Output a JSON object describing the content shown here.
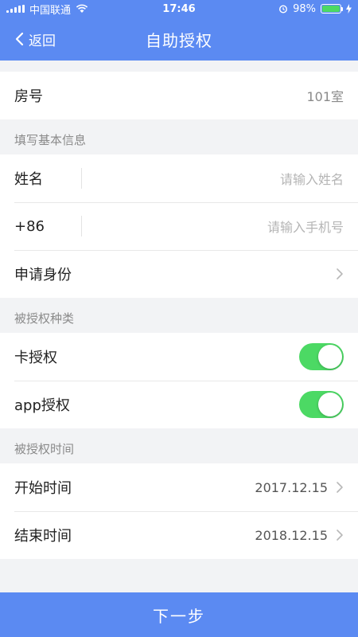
{
  "status_bar": {
    "carrier": "中国联通",
    "time": "17:46",
    "battery": "98%",
    "battery_level": 0.98
  },
  "nav": {
    "back_label": "返回",
    "title": "自助授权"
  },
  "room": {
    "label": "房号",
    "value": "101室"
  },
  "basic_info": {
    "section_title": "填写基本信息",
    "name": {
      "label": "姓名",
      "placeholder": "请输入姓名"
    },
    "phone": {
      "label": "+86",
      "placeholder": "请输入手机号"
    },
    "identity": {
      "label": "申请身份"
    }
  },
  "auth_types": {
    "section_title": "被授权种类",
    "card": {
      "label": "卡授权",
      "enabled": true
    },
    "app": {
      "label": "app授权",
      "enabled": true
    }
  },
  "auth_time": {
    "section_title": "被授权时间",
    "start": {
      "label": "开始时间",
      "value": "2017.12.15"
    },
    "end": {
      "label": "结束时间",
      "value": "2018.12.15"
    }
  },
  "next_button": {
    "label": "下一步"
  },
  "colors": {
    "primary": "#5b8af2",
    "toggle_on": "#4cd964"
  }
}
